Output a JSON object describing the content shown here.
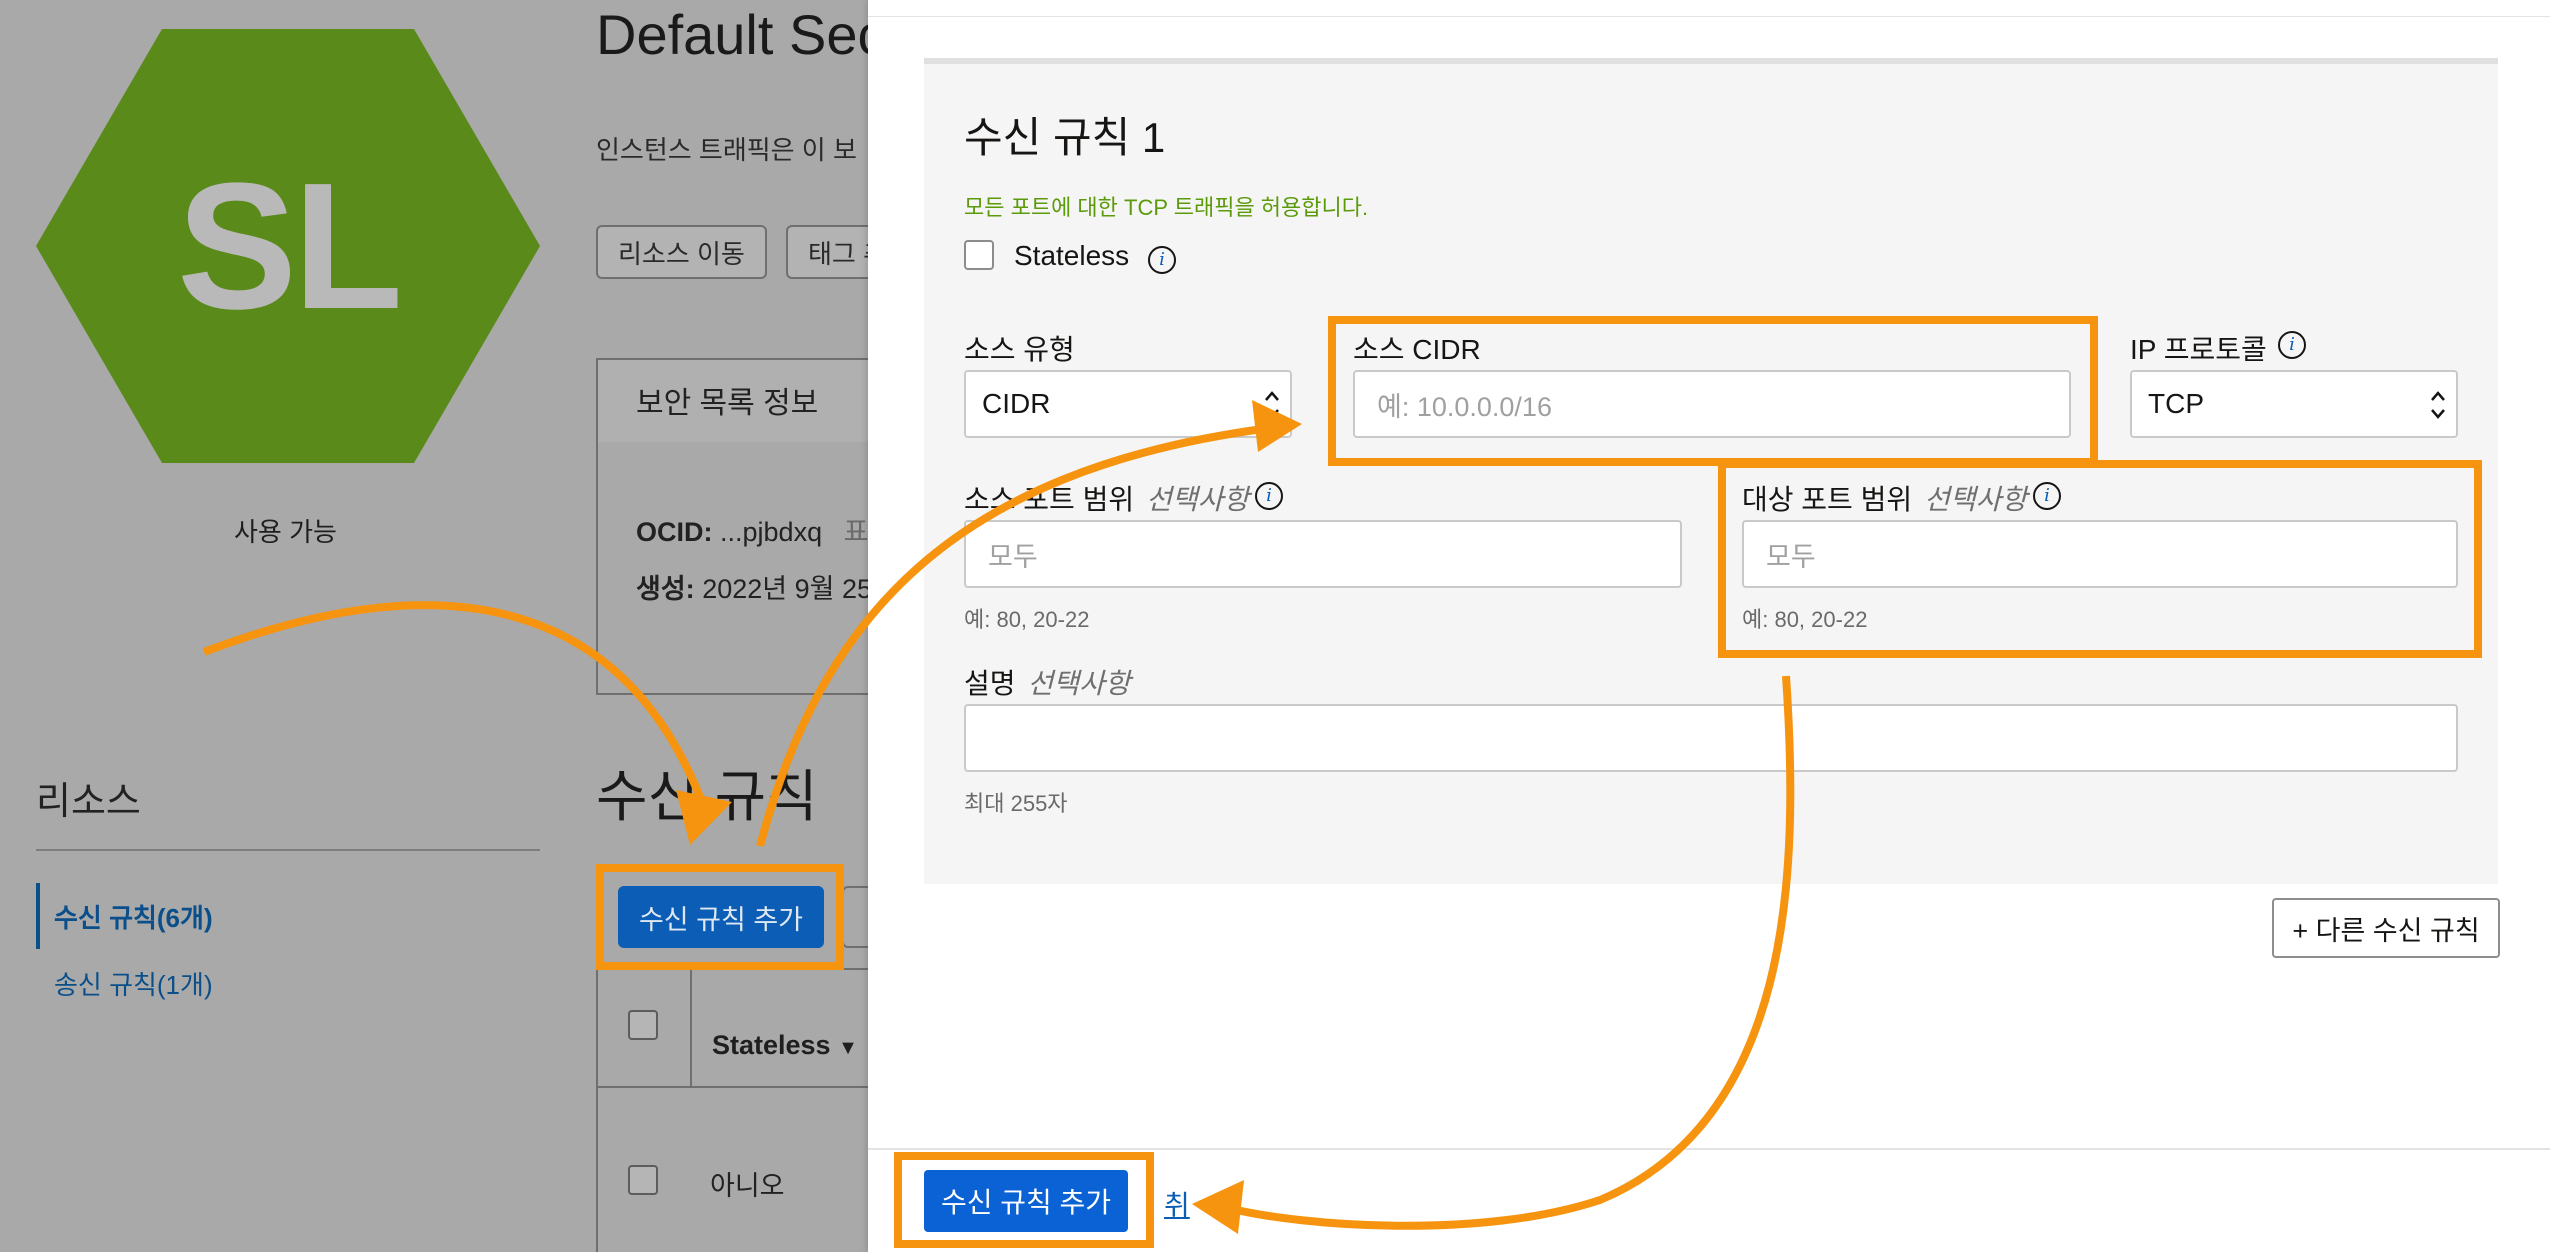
{
  "background": {
    "logo": {
      "text": "SL",
      "color": "#5a8a1a"
    },
    "status": "사용 가능",
    "page_title": "Default Sec",
    "page_description": "인스턴스 트래픽은 이 보",
    "buttons": [
      "리소스 이동",
      "태그 추"
    ],
    "tab_label": "보안 목록 정보",
    "ocid_label": "OCID:",
    "ocid_value": "...pjbdxq",
    "ocid_trailing": "표",
    "created_label": "생성:",
    "created_value": "2022년 9월 25",
    "resources_title": "리소스",
    "resources_items": [
      "수신 규칙(6개)",
      "송신 규칙(1개)"
    ],
    "section_title": "수신 규칙",
    "add_button": "수신 규칙 추가",
    "table_header": "Stateless",
    "table_cell": "아니오"
  },
  "drawer": {
    "rule_title": "수신 규칙 1",
    "rule_hint": "모든 포트에 대한 TCP 트래픽을 허용합니다.",
    "stateless_label": "Stateless",
    "source_type": {
      "label": "소스 유형",
      "value": "CIDR"
    },
    "source_cidr": {
      "label": "소스 CIDR",
      "placeholder": "예: 10.0.0.0/16"
    },
    "ip_protocol": {
      "label": "IP 프로토콜",
      "value": "TCP"
    },
    "source_port": {
      "label": "소스 포트 범위",
      "optional": "선택사항",
      "placeholder": "모두",
      "help": "예: 80, 20-22"
    },
    "dest_port": {
      "label": "대상 포트 범위",
      "optional": "선택사항",
      "placeholder": "모두",
      "help": "예: 80, 20-22"
    },
    "description": {
      "label": "설명",
      "optional": "선택사항",
      "help": "최대 255자"
    },
    "another_rule_button": "+ 다른 수신 규칙",
    "submit_button": "수신 규칙 추가",
    "cancel_link": "취"
  },
  "colors": {
    "highlight": "#f7940f",
    "primary": "#0b62d4",
    "hint_green": "#5b9a0a",
    "link": "#0b5db5"
  }
}
